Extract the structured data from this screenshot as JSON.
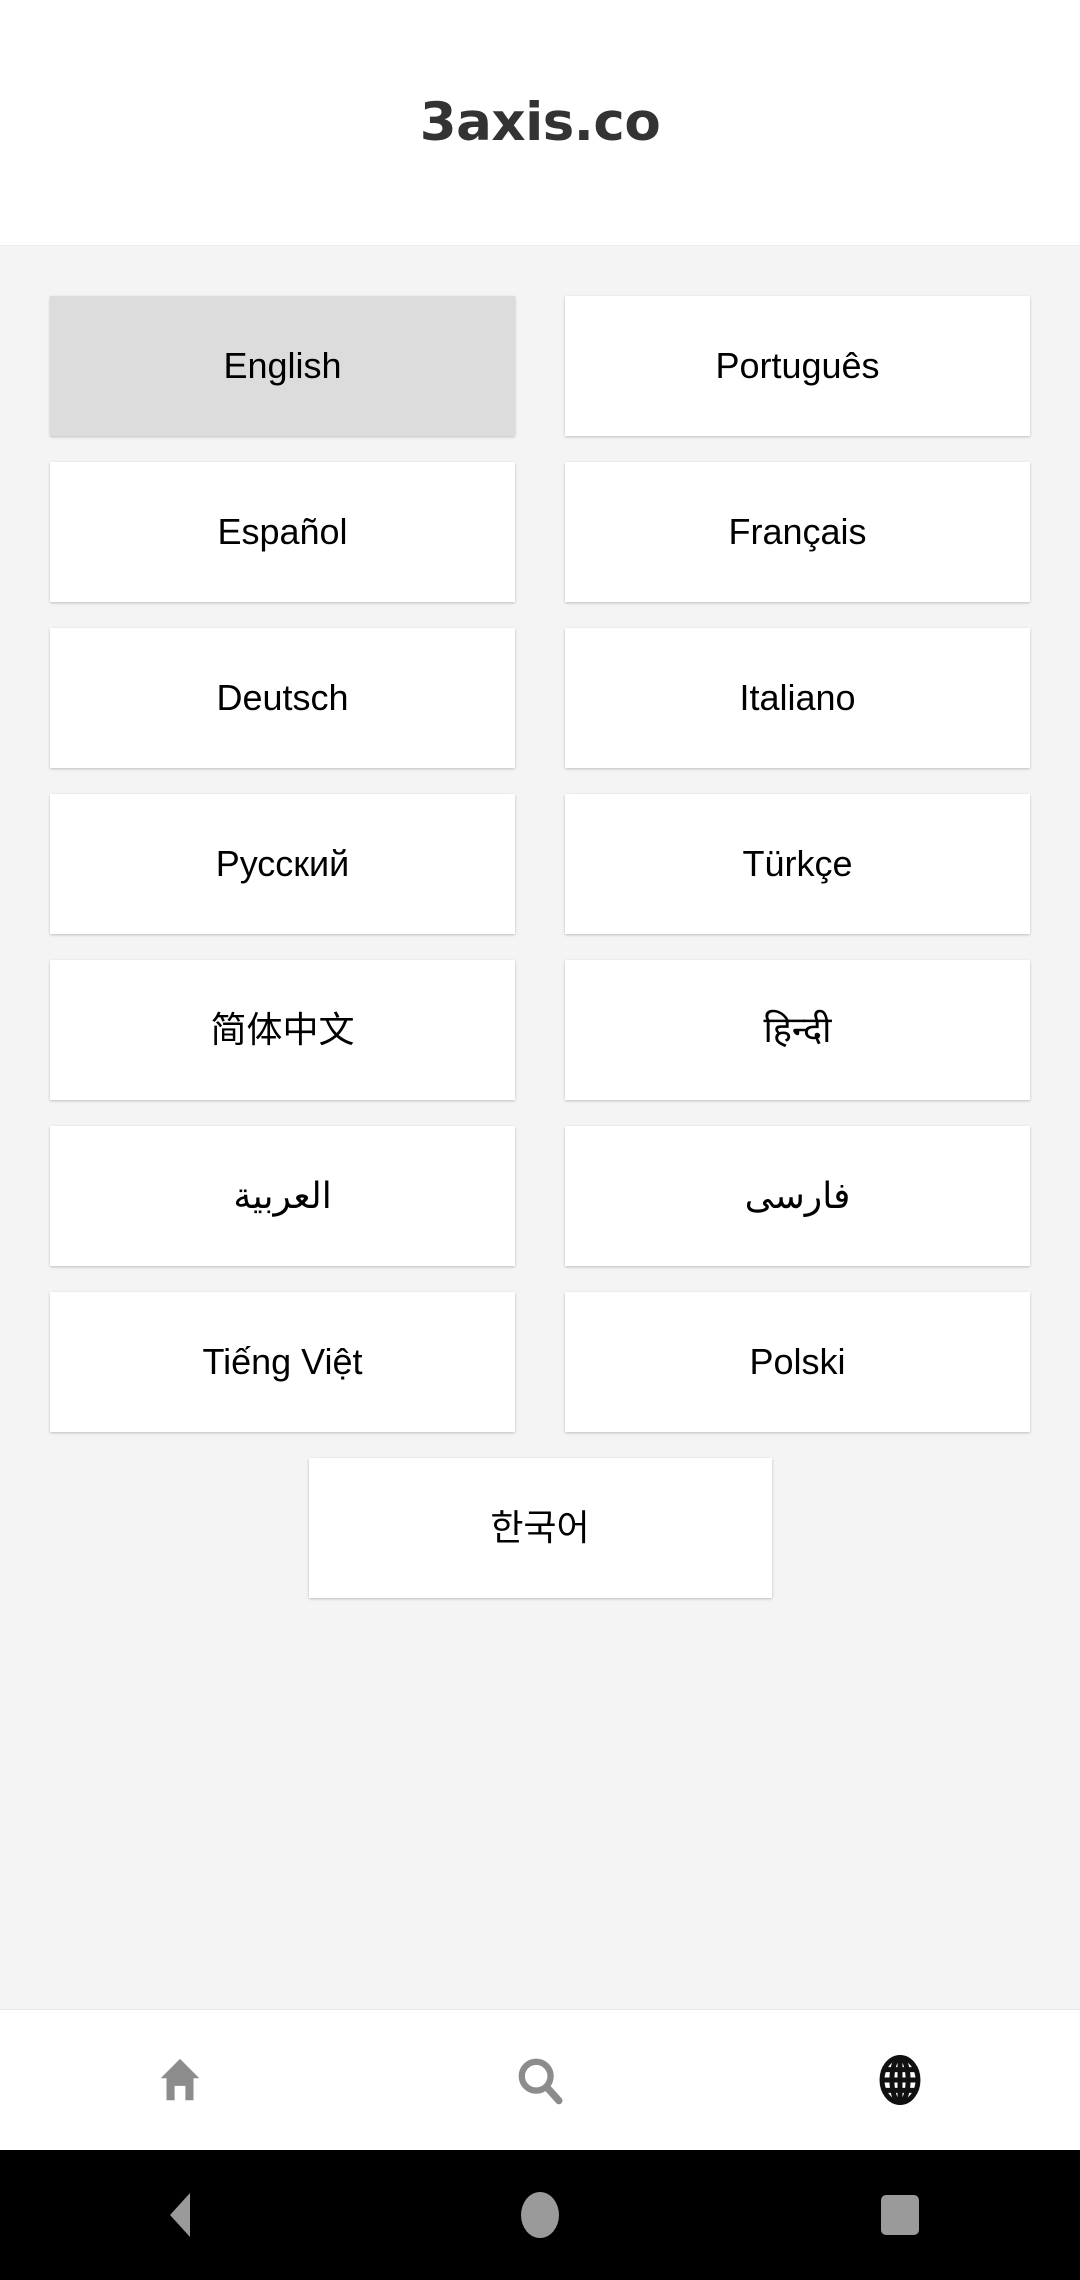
{
  "header": {
    "logo_text": "3axis.co"
  },
  "language_picker": {
    "selected": "English",
    "languages": [
      {
        "label": "English",
        "rtl": false,
        "selected": true
      },
      {
        "label": "Português",
        "rtl": false,
        "selected": false
      },
      {
        "label": "Español",
        "rtl": false,
        "selected": false
      },
      {
        "label": "Français",
        "rtl": false,
        "selected": false
      },
      {
        "label": "Deutsch",
        "rtl": false,
        "selected": false
      },
      {
        "label": "Italiano",
        "rtl": false,
        "selected": false
      },
      {
        "label": "Русский",
        "rtl": false,
        "selected": false
      },
      {
        "label": "Türkçe",
        "rtl": false,
        "selected": false
      },
      {
        "label": "简体中文",
        "rtl": false,
        "selected": false
      },
      {
        "label": "हिन्दी",
        "rtl": false,
        "selected": false
      },
      {
        "label": "العربية",
        "rtl": true,
        "selected": false
      },
      {
        "label": "فارسی",
        "rtl": true,
        "selected": false
      },
      {
        "label": "Tiếng Việt",
        "rtl": false,
        "selected": false
      },
      {
        "label": "Polski",
        "rtl": false,
        "selected": false
      },
      {
        "label": "한국어",
        "rtl": false,
        "selected": false
      }
    ]
  },
  "app_nav": {
    "items": [
      {
        "icon": "home-icon",
        "name": "nav-home",
        "active": false
      },
      {
        "icon": "search-icon",
        "name": "nav-search",
        "active": false
      },
      {
        "icon": "globe-icon",
        "name": "nav-language",
        "active": true
      }
    ],
    "inactive_color": "#8c8c8c",
    "active_color": "#111111"
  },
  "system_nav": {
    "items": [
      {
        "icon": "back-triangle-icon",
        "name": "system-back"
      },
      {
        "icon": "home-circle-icon",
        "name": "system-home"
      },
      {
        "icon": "recents-square-icon",
        "name": "system-recents"
      }
    ],
    "background": "#000000",
    "icon_color": "#9a9a9a"
  },
  "colors": {
    "page_background": "#f4f4f4",
    "card_background": "#ffffff",
    "card_selected_background": "#dcdcdc",
    "header_background": "#ffffff",
    "logo_color": "#333333",
    "text_color": "#000000"
  }
}
